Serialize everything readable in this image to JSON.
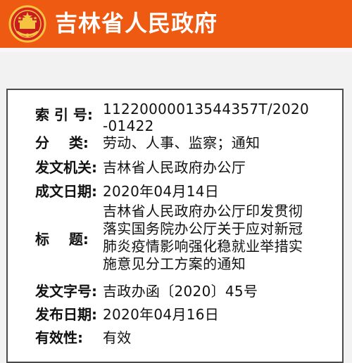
{
  "header": {
    "site_title": "吉林省人民政府",
    "emblem_icon": "national-emblem-icon",
    "background_color": "#ee5a12"
  },
  "document_info": {
    "index_no": {
      "label": "索 引 号:",
      "value": "11220000013544357T/2020-01422"
    },
    "category": {
      "label": "分    类:",
      "value": "劳动、人事、监察；通知"
    },
    "issuing_org": {
      "label": "发文机关:",
      "value": "吉林省人民政府办公厅"
    },
    "creation_date": {
      "label": "成文日期:",
      "value": "2020年04月14日"
    },
    "title": {
      "label": "标    题:",
      "value": "吉林省人民政府办公厅印发贯彻落实国务院办公厅关于应对新冠肺炎疫情影响强化稳就业举措实施意见分工方案的通知"
    },
    "document_no": {
      "label": "发文字号:",
      "value": "吉政办函〔2020〕45号"
    },
    "publish_date": {
      "label": "发布日期:",
      "value": "2020年04月16日"
    },
    "validity": {
      "label": "有效性:",
      "value": "有效"
    }
  }
}
